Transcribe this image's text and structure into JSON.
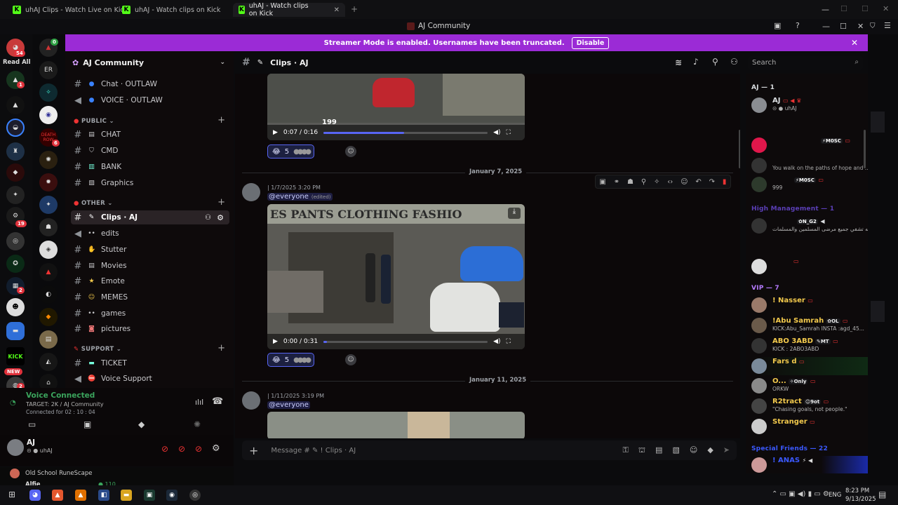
{
  "browser": {
    "tabs": [
      {
        "title": "uhAJ Clips - Watch Live on Kick",
        "active": false
      },
      {
        "title": "uhAJ - Watch clips on Kick",
        "active": false
      },
      {
        "title": "uhAJ - Watch clips on Kick",
        "active": true
      }
    ],
    "new_tab_glyph": "+"
  },
  "window": {
    "title": "AJ Community"
  },
  "rail": {
    "read_all_label": "Read All",
    "badges": [
      "54",
      "1",
      "1",
      "19",
      "2",
      "2",
      "2"
    ],
    "new_label": "NEW",
    "kick_label": "KICK",
    "death_label": "DEATH ROW",
    "death_badge": "6"
  },
  "banner": {
    "text": "Streamer Mode is enabled. Usernames have been truncated.",
    "disable_label": "Disable",
    "color": "#9b2bd6"
  },
  "server": {
    "name": "AJ Community"
  },
  "sidebar": {
    "top_channels": [
      {
        "name": "Chat · OUTLAW",
        "type": "text",
        "icon": "blue-dot"
      },
      {
        "name": "VOICE · OUTLAW",
        "type": "voice",
        "icon": "blue-dot"
      }
    ],
    "categories": [
      {
        "name": "PUBLIC",
        "channels": [
          {
            "name": "CHAT",
            "type": "text",
            "icon": "chat"
          },
          {
            "name": "CMD",
            "type": "text",
            "icon": "shield"
          },
          {
            "name": "BANK",
            "type": "text",
            "icon": "bank"
          },
          {
            "name": "Graphics",
            "type": "text",
            "icon": "image"
          }
        ]
      },
      {
        "name": "OTHER",
        "channels": [
          {
            "name": "Clips · AJ",
            "type": "text",
            "icon": "pen",
            "selected": true
          },
          {
            "name": "edits",
            "type": "voice",
            "icon": "dots"
          },
          {
            "name": "Stutter",
            "type": "text",
            "icon": "hand"
          },
          {
            "name": "Movies",
            "type": "text",
            "icon": "film"
          },
          {
            "name": "Emote",
            "type": "text",
            "icon": "star"
          },
          {
            "name": "MEMES",
            "type": "text",
            "icon": "laugh"
          },
          {
            "name": "games",
            "type": "text",
            "icon": "dots"
          },
          {
            "name": "pictures",
            "type": "text",
            "icon": "camera"
          }
        ]
      },
      {
        "name": "SUPPORT",
        "channels": [
          {
            "name": "TICKET",
            "type": "text",
            "icon": "ticket"
          },
          {
            "name": "Voice Support",
            "type": "voice",
            "icon": "no-entry"
          }
        ]
      }
    ]
  },
  "voice": {
    "status": "Voice Connected",
    "target": "TARGET: 2K / AJ Community",
    "duration": "Connected for 02 : 10 : 04"
  },
  "user": {
    "name": "AJ",
    "sub": "uhAJ"
  },
  "activity": {
    "game": "Old School RuneScape",
    "friend": "Alfie",
    "count": "110"
  },
  "channel": {
    "name": "Clips · AJ"
  },
  "search": {
    "placeholder": "Search"
  },
  "messages": {
    "video1": {
      "overlay_number": "199",
      "time": "0:07 / 0:16",
      "progress": 0.49
    },
    "reaction1": {
      "count": "5"
    },
    "date1": "January 7, 2025",
    "msg1": {
      "timestamp": "1/7/2025 3:20 PM",
      "content": "@everyone",
      "edited": "(edited)"
    },
    "video2": {
      "sign_text": "ES PANTS CLOTHING FASHIO",
      "time": "0:00 / 0:31",
      "progress": 0.0
    },
    "reaction2": {
      "count": "5"
    },
    "date2": "January 11, 2025",
    "msg2": {
      "timestamp": "1/11/2025 3:19 PM",
      "content": "@everyone"
    }
  },
  "composer": {
    "placeholder": "Message # ✎ ! Clips · AJ"
  },
  "members": {
    "groups": [
      {
        "title": "AJ — 1",
        "color": "#dbdee1"
      },
      {
        "title": "High Management — 1",
        "color": "#5b3fb8"
      },
      {
        "title": "VIP — 7",
        "color": "#b57bff"
      },
      {
        "title": "Special Friends — 22",
        "color": "#3b59ff"
      }
    ],
    "list": [
      {
        "name": "AJ",
        "sub": "uhAJ",
        "color": "#ffffff"
      },
      {
        "name": "M0SC",
        "sub": "You walk on the paths of hope and ...",
        "color": "#ff3355"
      },
      {
        "name": "M0SC",
        "sub": "999",
        "color": "#ff3355"
      },
      {
        "name": "N_G2",
        "sub": "يارب الله تشفي جميع مرضى المسلمين والمسلمات",
        "color": "#dddddd"
      },
      {
        "name": "! Nasser",
        "sub": "",
        "color": "#f2c94c"
      },
      {
        "name": "!Abu Samrah",
        "sub": "KICK:Abu_Samrah INSTA :agd_45...",
        "color": "#f2c94c",
        "tag": "OL"
      },
      {
        "name": "ABO 3ABD",
        "sub": "KICK : 2ABO3ABD",
        "color": "#f2c94c",
        "tag": "MT"
      },
      {
        "name": "Fars d",
        "sub": "",
        "color": "#f2c94c"
      },
      {
        "name": "O...",
        "sub": "ORKW",
        "color": "#f2c94c",
        "tag": "Only"
      },
      {
        "name": "R2tract",
        "sub": "\"Chasing goals, not people.\"",
        "color": "#f2c94c",
        "tag": "9ot"
      },
      {
        "name": "Stranger",
        "sub": "",
        "color": "#f2c94c"
      },
      {
        "name": "! ANAS",
        "sub": "",
        "color": "#3b59ff"
      }
    ]
  },
  "taskbar": {
    "language": "ENG",
    "time": "8:23 PM",
    "date": "9/13/2025"
  }
}
